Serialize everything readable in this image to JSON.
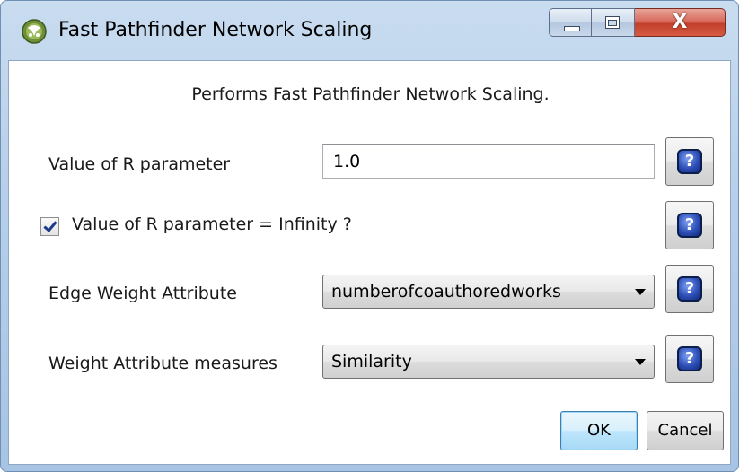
{
  "window": {
    "title": "Fast Pathfinder Network Scaling",
    "app_icon": "cytoscape-logo-icon",
    "controls": {
      "minimize": "minimize-icon",
      "maximize": "maximize-icon",
      "close_glyph": "X"
    }
  },
  "dialog": {
    "description": "Performs Fast Pathfinder Network Scaling.",
    "r_parameter": {
      "label": "Value of R parameter",
      "value": "1.0"
    },
    "r_infinity": {
      "label": "Value of R parameter = Infinity ?",
      "checked": true
    },
    "edge_weight": {
      "label": "Edge Weight Attribute",
      "selected": "numberofcoauthoredworks"
    },
    "weight_measures": {
      "label": "Weight Attribute measures",
      "selected": "Similarity"
    },
    "help_icon": "help-question-icon",
    "buttons": {
      "ok": "OK",
      "cancel": "Cancel"
    }
  },
  "colors": {
    "titlebar": "#b7cfea",
    "ok_button_highlight": "#bee6fd",
    "close_button": "#c2402b",
    "help_icon": "#2d4fb8"
  }
}
